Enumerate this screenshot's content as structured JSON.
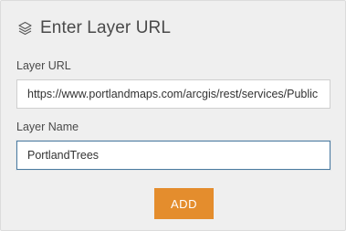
{
  "panel": {
    "title": "Enter Layer URL",
    "icon": "layers-icon"
  },
  "url_field": {
    "label": "Layer URL",
    "value": "https://www.portlandmaps.com/arcgis/rest/services/Public"
  },
  "name_field": {
    "label": "Layer Name",
    "value": "PortlandTrees"
  },
  "add_button": {
    "label": "ADD",
    "color": "#e48d2d"
  }
}
